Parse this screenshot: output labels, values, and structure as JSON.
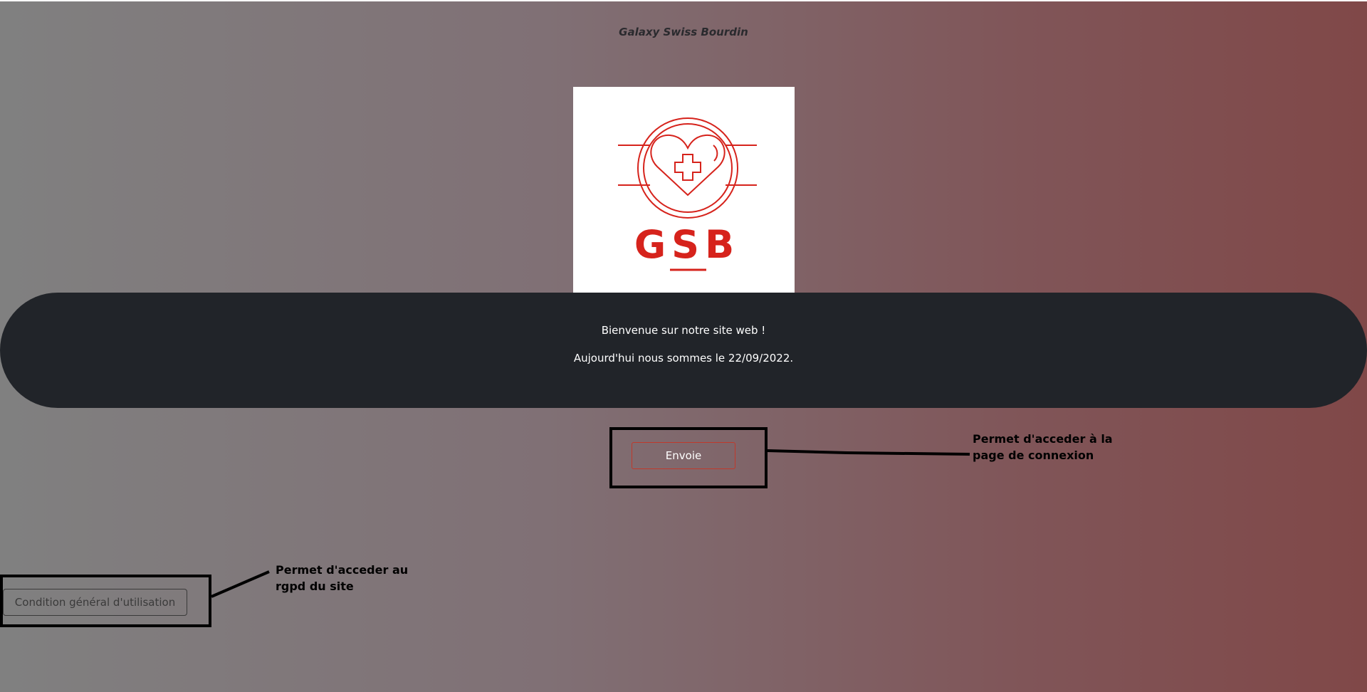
{
  "header": {
    "title": "Galaxy Swiss Bourdin"
  },
  "logo": {
    "text": "GSB",
    "icon": "heart-cross-icon",
    "color": "#d6231c"
  },
  "welcome": {
    "line1": "Bienvenue sur notre site web !",
    "line2": "Aujourd'hui nous sommes le 22/09/2022."
  },
  "actions": {
    "send_label": "Envoie",
    "cgu_label": "Condition général d'utilisation"
  },
  "annotations": {
    "send_line1": "Permet d'acceder à la",
    "send_line2": "page de connexion",
    "cgu_line1": "Permet d'acceder au",
    "cgu_line2": "rgpd du site"
  },
  "colors": {
    "banner": "#212429",
    "gradient_left": "#808080",
    "gradient_right": "#804848",
    "button_border": "#c0392b"
  }
}
